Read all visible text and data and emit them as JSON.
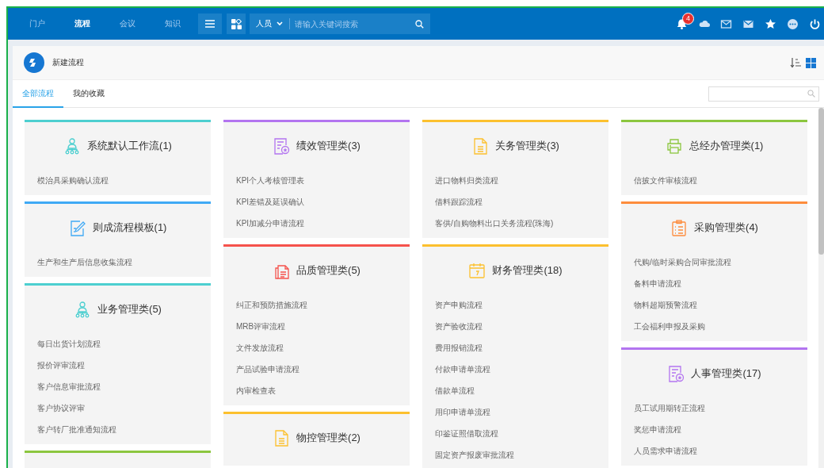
{
  "top_nav": {
    "tabs": [
      {
        "label": "门户",
        "selected": false
      },
      {
        "label": "流程",
        "selected": true
      },
      {
        "label": "会议",
        "selected": false
      },
      {
        "label": "知识",
        "selected": false
      }
    ],
    "search": {
      "scope": "人员",
      "placeholder": "请输入关键词搜索"
    },
    "notification_count": "4"
  },
  "page_header": {
    "title": "新建流程"
  },
  "tabs": [
    {
      "label": "全部流程",
      "selected": true
    },
    {
      "label": "我的收藏",
      "selected": false
    }
  ],
  "columns": [
    {
      "categories": [
        {
          "title": "系统默认工作流(1)",
          "kind": "org",
          "color": "#4dcfd0",
          "items": [
            "模治具采购确认流程"
          ]
        },
        {
          "title": "则成流程模板(1)",
          "kind": "edit",
          "color": "#3fa9f5",
          "items": [
            "生产和生产后信息收集流程"
          ]
        },
        {
          "title": "业务管理类(5)",
          "kind": "org",
          "color": "#4dcfd0",
          "items": [
            "每日出货计划流程",
            "报价评审流程",
            "客户信息审批流程",
            "客户协议评审",
            "客户转厂批准通知流程"
          ]
        },
        {
          "kind": "none",
          "color": "#8cc63f"
        }
      ]
    },
    {
      "categories": [
        {
          "title": "绩效管理类(3)",
          "kind": "award",
          "color": "#b374f0",
          "items": [
            "KPI个人考核管理表",
            "KPI差错及延误确认",
            "KPI加减分申请流程"
          ]
        },
        {
          "title": "品质管理类(5)",
          "kind": "copies",
          "color": "#f5524c",
          "items": [
            "纠正和预防措施流程",
            "MRB评审流程",
            "文件发放流程",
            "产品试验申请流程",
            "内审检查表"
          ]
        },
        {
          "title": "物控管理类(2)",
          "kind": "file",
          "color": "#fcc02e"
        }
      ]
    },
    {
      "categories": [
        {
          "title": "关务管理类(3)",
          "kind": "file",
          "color": "#fcc02e",
          "items": [
            "进口物料归类流程",
            "借料跟踪流程",
            "客供/自购物料出口关务流程(珠海)"
          ]
        },
        {
          "title": "财务管理类(18)",
          "kind": "calendar",
          "color": "#fcc02e",
          "items": [
            "资产申购流程",
            "资产验收流程",
            "费用报销流程",
            "付款申请单流程",
            "借款单流程",
            "用印申请单流程",
            "印鉴证照借取流程",
            "固定资产报废审批流程"
          ]
        }
      ]
    },
    {
      "categories": [
        {
          "title": "总经办管理类(1)",
          "kind": "printer",
          "color": "#8cc63f",
          "items": [
            "信披文件审核流程"
          ]
        },
        {
          "title": "采购管理类(4)",
          "kind": "list",
          "color": "#fd8c3c",
          "items": [
            "代购/临时采购合同审批流程",
            "备料申请流程",
            "物料超期预警流程",
            "工会福利申报及采购"
          ]
        },
        {
          "title": "人事管理类(17)",
          "kind": "award",
          "color": "#b374f0",
          "items": [
            "员工试用期转正流程",
            "奖惩申请流程",
            "人员需求申请流程"
          ]
        }
      ]
    }
  ]
}
